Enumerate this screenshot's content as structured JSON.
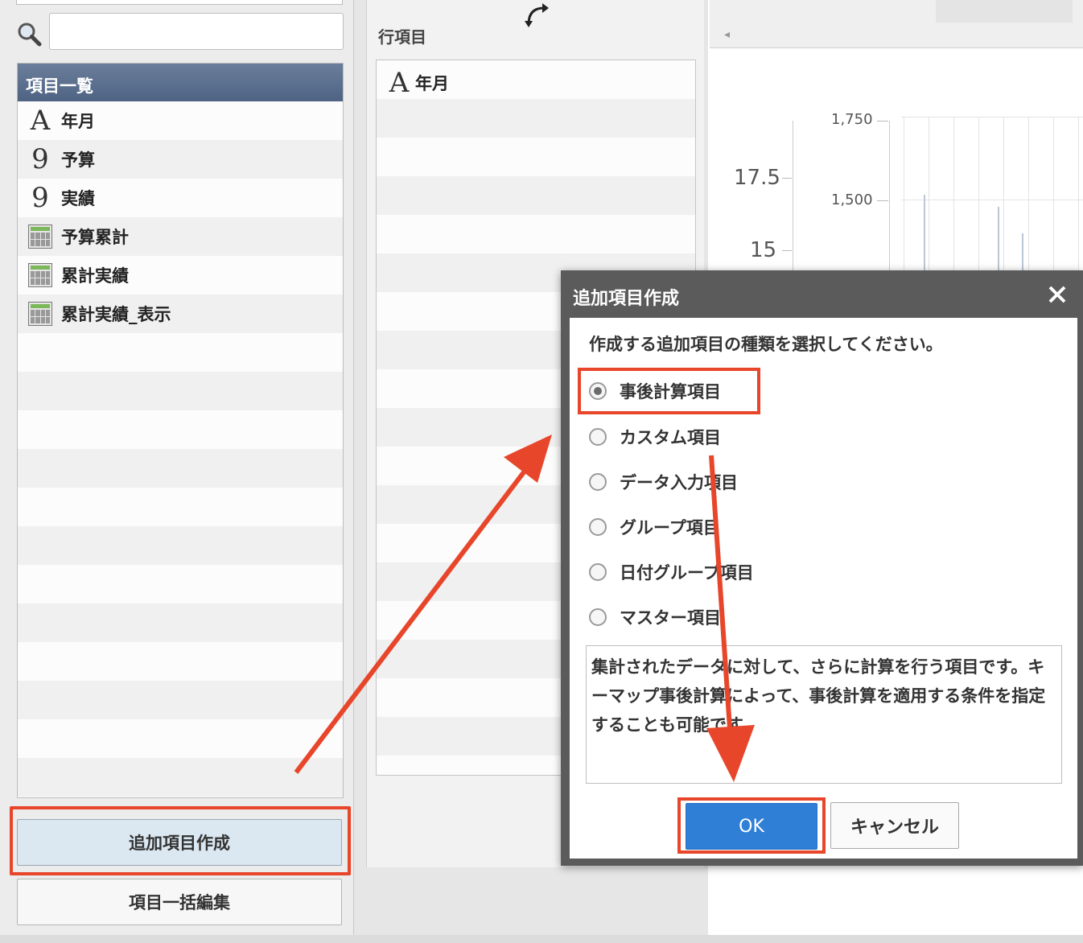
{
  "left_panel": {
    "search": {
      "placeholder": ""
    },
    "list_header": "項目一覧",
    "items": [
      {
        "type_icon": "A",
        "label": "年月"
      },
      {
        "type_icon": "9",
        "label": "予算"
      },
      {
        "type_icon": "9",
        "label": "実績"
      },
      {
        "type_icon": "calculator",
        "label": "予算累計"
      },
      {
        "type_icon": "calculator",
        "label": "累計実績"
      },
      {
        "type_icon": "calculator",
        "label": "累計実績_表示"
      }
    ],
    "add_button": "追加項目作成",
    "bulk_edit_button": "項目一括編集"
  },
  "middle_panel": {
    "row_items_label": "行項目",
    "row_items": [
      {
        "type_icon": "A",
        "label": "年月"
      }
    ]
  },
  "chart": {
    "left_ticks": [
      "17.5",
      "15"
    ],
    "right_ticks": [
      "1,750",
      "1,500"
    ]
  },
  "dialog": {
    "title": "追加項目作成",
    "instruction": "作成する追加項目の種類を選択してください。",
    "options": [
      {
        "label": "事後計算項目",
        "selected": true
      },
      {
        "label": "カスタム項目",
        "selected": false
      },
      {
        "label": "データ入力項目",
        "selected": false
      },
      {
        "label": "グループ項目",
        "selected": false
      },
      {
        "label": "日付グループ項目",
        "selected": false
      },
      {
        "label": "マスター項目",
        "selected": false
      }
    ],
    "description": "集計されたデータに対して、さらに計算を行う項目です。キーマップ事後計算によって、事後計算を適用する条件を指定することも可能です。",
    "ok_button": "OK",
    "cancel_button": "キャンセル"
  },
  "colors": {
    "annotation": "#e8462b",
    "ok_button": "#2f7fd6",
    "list_header": "#546889"
  }
}
